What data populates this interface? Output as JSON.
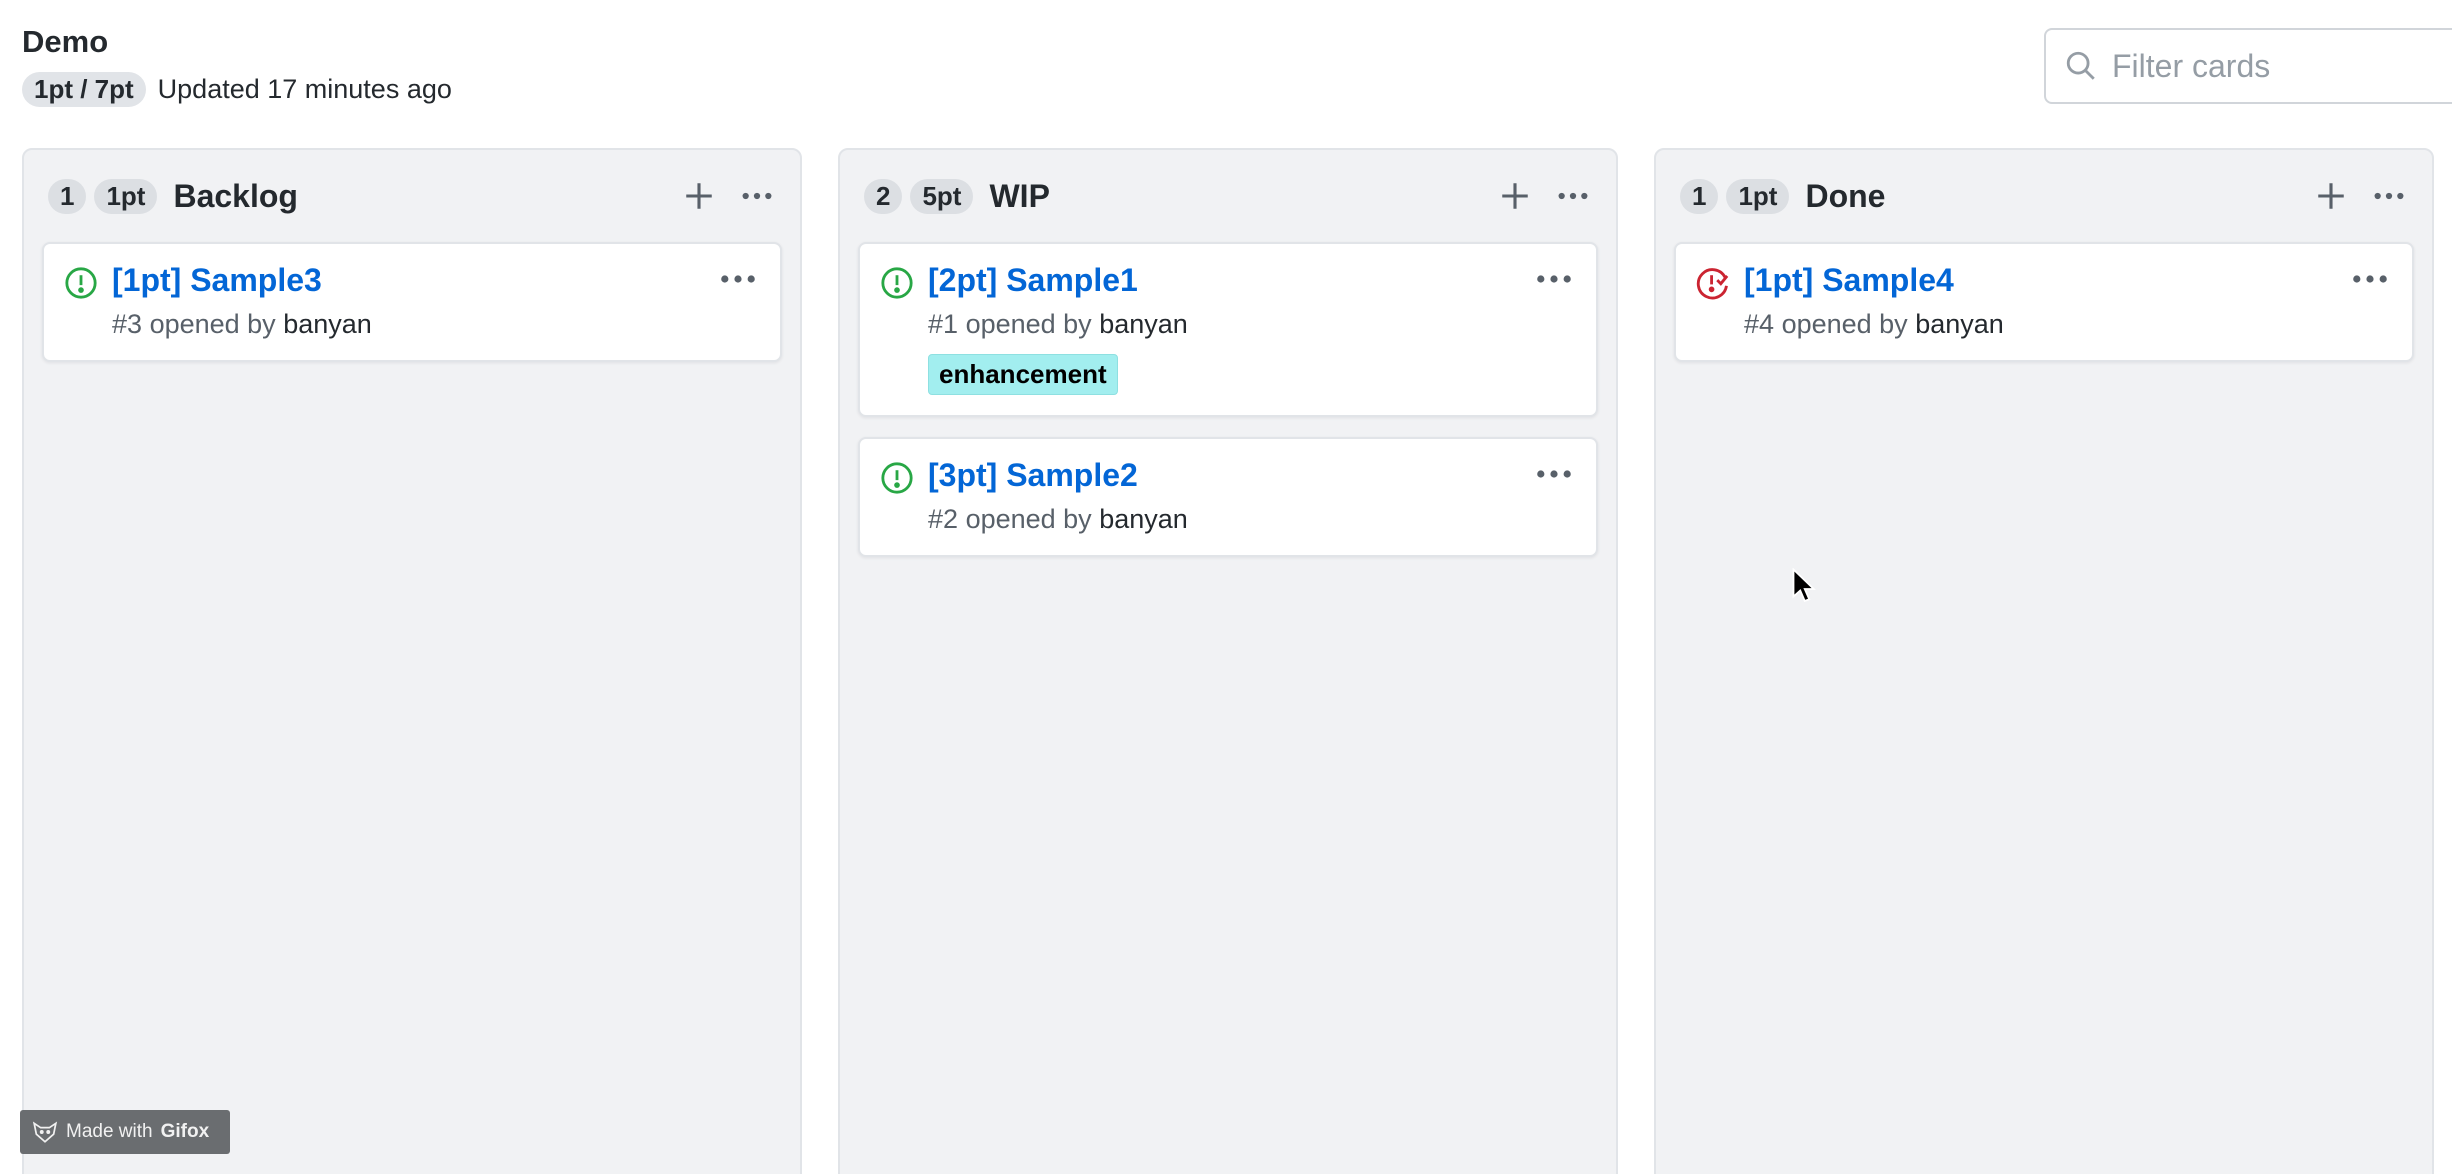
{
  "header": {
    "title": "Demo",
    "points_pill": "1pt / 7pt",
    "updated": "Updated 17 minutes ago"
  },
  "filter": {
    "placeholder": "Filter cards",
    "value": ""
  },
  "colors": {
    "open_issue": "#28a745",
    "closed_issue": "#cb2431",
    "link": "#0366d6",
    "label_enhancement": "#a2eeef"
  },
  "columns": [
    {
      "count": "1",
      "points": "1pt",
      "title": "Backlog",
      "cards": [
        {
          "title": "[1pt] Sample3",
          "number": "#3",
          "opened_by": "opened by",
          "author": "banyan",
          "status": "open"
        }
      ]
    },
    {
      "count": "2",
      "points": "5pt",
      "title": "WIP",
      "cards": [
        {
          "title": "[2pt] Sample1",
          "number": "#1",
          "opened_by": "opened by",
          "author": "banyan",
          "status": "open",
          "label": "enhancement"
        },
        {
          "title": "[3pt] Sample2",
          "number": "#2",
          "opened_by": "opened by",
          "author": "banyan",
          "status": "open"
        }
      ]
    },
    {
      "count": "1",
      "points": "1pt",
      "title": "Done",
      "cards": [
        {
          "title": "[1pt] Sample4",
          "number": "#4",
          "opened_by": "opened by",
          "author": "banyan",
          "status": "closed"
        }
      ]
    }
  ],
  "watermark": {
    "prefix": "Made with",
    "brand": "Gifox"
  }
}
